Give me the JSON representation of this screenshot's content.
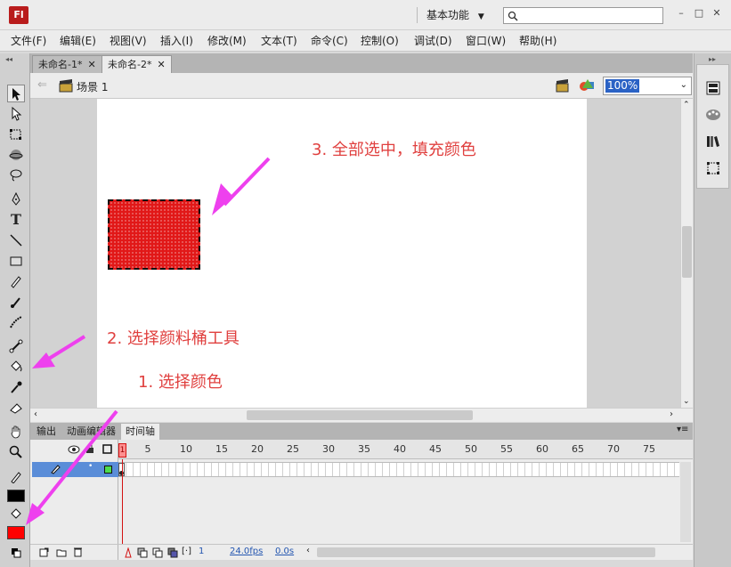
{
  "app": {
    "logo": "Fl",
    "workspace": "基本功能",
    "workspace_arrow": "▼"
  },
  "search": {
    "placeholder": ""
  },
  "window_controls": {
    "minimize": "–",
    "restore": "□",
    "close": "✕"
  },
  "menu": [
    "文件(F)",
    "编辑(E)",
    "视图(V)",
    "插入(I)",
    "修改(M)",
    "文本(T)",
    "命令(C)",
    "控制(O)",
    "调试(D)",
    "窗口(W)",
    "帮助(H)"
  ],
  "doc_tabs": [
    {
      "label": "未命名-1*",
      "active": false
    },
    {
      "label": "未命名-2*",
      "active": true
    }
  ],
  "tab_close": "✕",
  "scene": {
    "label": "场景 1",
    "zoom": "100%"
  },
  "annotations": {
    "step3": "3. 全部选中，填充颜色",
    "step2": "2. 选择颜料桶工具",
    "step1": "1. 选择颜色"
  },
  "panel_tabs": [
    "输出",
    "动画编辑器",
    "时间轴"
  ],
  "timeline": {
    "frame_labels": [
      "1",
      "5",
      "10",
      "15",
      "20",
      "25",
      "30",
      "35",
      "40",
      "45",
      "50",
      "55",
      "60",
      "65",
      "70",
      "75"
    ],
    "current_frame": "1",
    "fps": "24.0fps",
    "time": "0.0s"
  },
  "colors": {
    "fill": "#ff0000",
    "stroke": "#000000",
    "annotation": "#e0403f",
    "arrow": "#ee40ee"
  },
  "tools": [
    "selection-icon",
    "subselection-icon",
    "free-transform-icon",
    "3d-rotation-icon",
    "lasso-icon",
    "pen-icon",
    "text-icon",
    "line-icon",
    "rectangle-icon",
    "pencil-icon",
    "brush-icon",
    "deco-icon",
    "bone-icon",
    "paint-bucket-icon",
    "eyedropper-icon",
    "eraser-icon",
    "hand-icon",
    "zoom-icon"
  ]
}
